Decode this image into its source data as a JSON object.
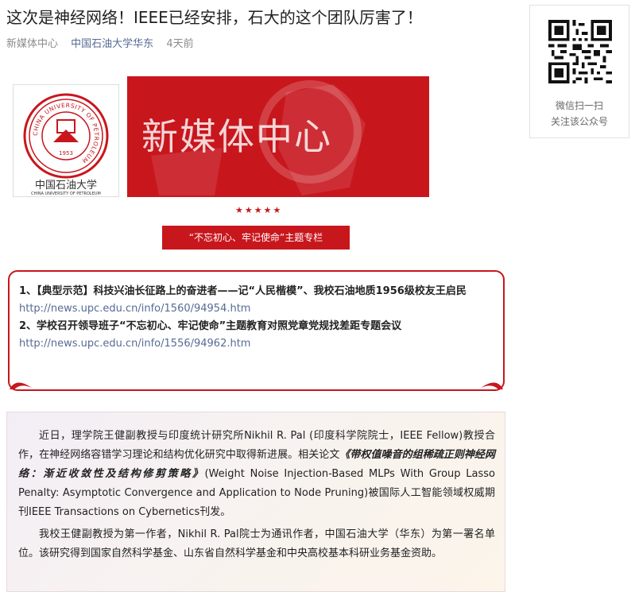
{
  "title": "这次是神经网络！IEEE已经安排，石大的这个团队厉害了！",
  "meta": {
    "source": "新媒体中心",
    "account": "中国石油大学华东",
    "time": "4天前"
  },
  "qr": {
    "caption_line1": "微信扫一扫",
    "caption_line2": "关注该公众号"
  },
  "banner": {
    "logo_ring_text": "CHINA UNIVERSITY OF PETROLEUM",
    "logo_year": "1953",
    "logo_cn": "中国石油大学",
    "logo_en": "CHINA UNIVERSITY OF PETROLEUM",
    "panel_title": "新媒体中心",
    "stars": "★★★★★",
    "theme_label": "“不忘初心、牢记使命”主题专栏",
    "accent": "#c8161d"
  },
  "links": {
    "item1_text": "1、【典型示范】科技兴油长征路上的奋进者——记“人民楷模”、我校石油地质1956级校友王启民",
    "item1_url": "http://news.upc.edu.cn/info/1560/94954.htm",
    "item2_text": "2、学校召开领导班子“不忘初心、牢记使命”主题教育对照党章党规找差距专题会议",
    "item2_url": "http://news.upc.edu.cn/info/1556/94962.htm"
  },
  "article": {
    "p1_a": "近日，理学院王健副教授与印度统计研究所Nikhil R. Pal (印度科学院院士，IEEE Fellow)教授合作，在神经网络容错学习理论和结构优化研究中取得新进展。相关论文",
    "p1_title": "《带权值噪音的组稀疏正则神经网络：渐近收敛性及结构修剪策略》",
    "p1_b": "(Weight Noise Injection-Based MLPs With Group Lasso Penalty: Asymptotic Convergence and Application to Node Pruning)被国际人工智能领域权威期刊IEEE Transactions on Cybernetics刊发。",
    "p2": "我校王健副教授为第一作者，Nikhil R. Pal院士为通讯作者，中国石油大学（华东）为第一署名单位。该研究得到国家自然科学基金、山东省自然科学基金和中央高校基本科研业务基金资助。"
  }
}
